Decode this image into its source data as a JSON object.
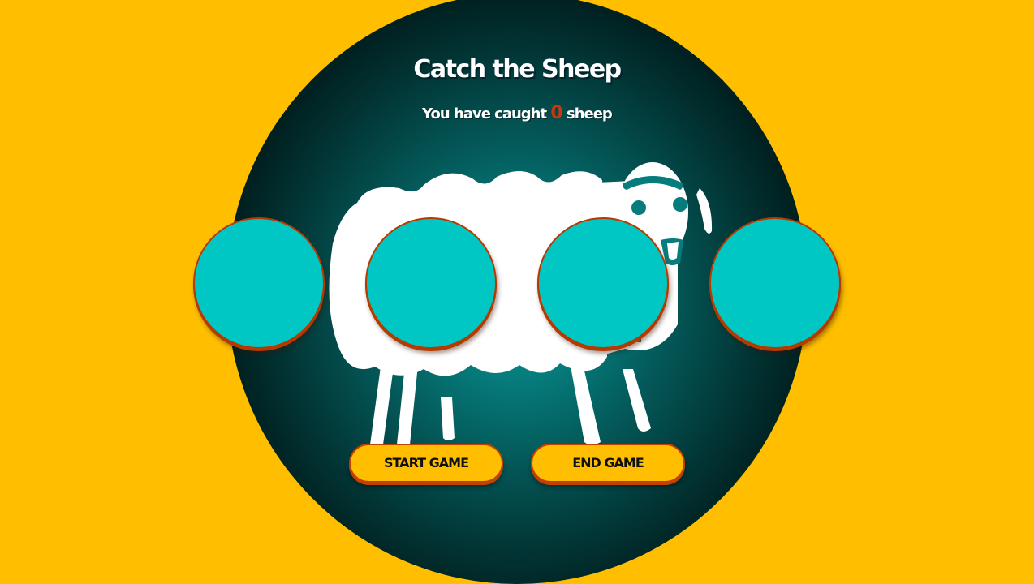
{
  "game": {
    "title": "Catch the Sheep",
    "score_prefix": "You have caught",
    "score_count": "0",
    "score_suffix": "sheep"
  },
  "holes": [
    {
      "id": 1
    },
    {
      "id": 2
    },
    {
      "id": 3
    },
    {
      "id": 4
    }
  ],
  "buttons": {
    "start_label": "START GAME",
    "end_label": "END GAME"
  },
  "colors": {
    "background": "#FFBE00",
    "hole_fill": "#00c7c4",
    "hole_border": "#b53a00",
    "score_count": "#c43a10"
  },
  "icons": {
    "sheep": "sheep-icon"
  }
}
